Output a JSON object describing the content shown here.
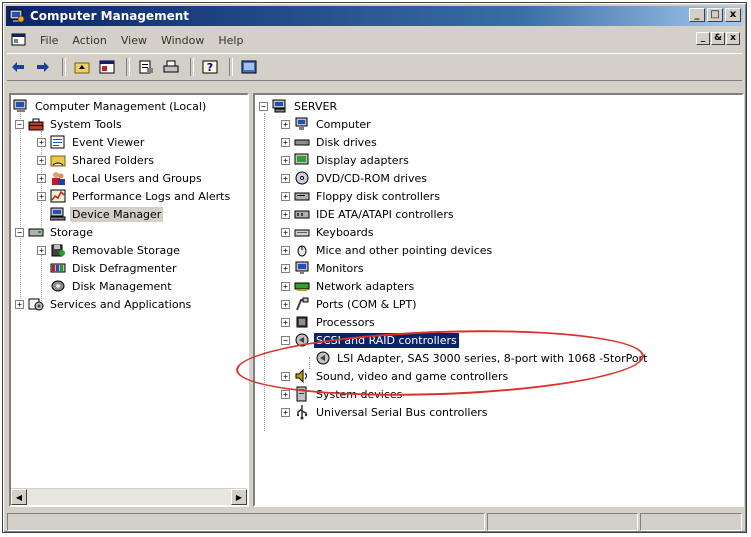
{
  "window": {
    "title": "Computer Management",
    "caption_buttons": [
      "_",
      "□",
      "x"
    ]
  },
  "menubar": {
    "items": [
      "File",
      "Action",
      "View",
      "Window",
      "Help"
    ],
    "mdi_buttons": [
      "_",
      "&",
      "x"
    ]
  },
  "toolbar": {
    "buttons": [
      "back-icon",
      "forward-icon",
      "up-folder-icon",
      "show-hide-tree-icon",
      "properties-icon",
      "print-icon",
      "help-icon",
      "device-view-icon"
    ]
  },
  "left_tree": {
    "root": "Computer Management (Local)",
    "system_tools": "System Tools",
    "event_viewer": "Event Viewer",
    "shared_folders": "Shared Folders",
    "local_users": "Local Users and Groups",
    "perf_logs": "Performance Logs and Alerts",
    "device_manager": "Device Manager",
    "storage": "Storage",
    "removable_storage": "Removable Storage",
    "disk_defrag": "Disk Defragmenter",
    "disk_mgmt": "Disk Management",
    "services": "Services and Applications"
  },
  "right_tree": {
    "server": "SERVER",
    "items": [
      "Computer",
      "Disk drives",
      "Display adapters",
      "DVD/CD-ROM drives",
      "Floppy disk controllers",
      "IDE ATA/ATAPI controllers",
      "Keyboards",
      "Mice and other pointing devices",
      "Monitors",
      "Network adapters",
      "Ports (COM & LPT)",
      "Processors",
      "SCSI and RAID controllers",
      "LSI Adapter, SAS 3000 series, 8-port with 1068 -StorPort",
      "Sound, video and game controllers",
      "System devices",
      "Universal Serial Bus controllers"
    ]
  },
  "colors": {
    "title_bar": "#0a246a",
    "selection": "#0a246a",
    "annotation": "#d9322a",
    "window_face": "#d4d0c8"
  }
}
